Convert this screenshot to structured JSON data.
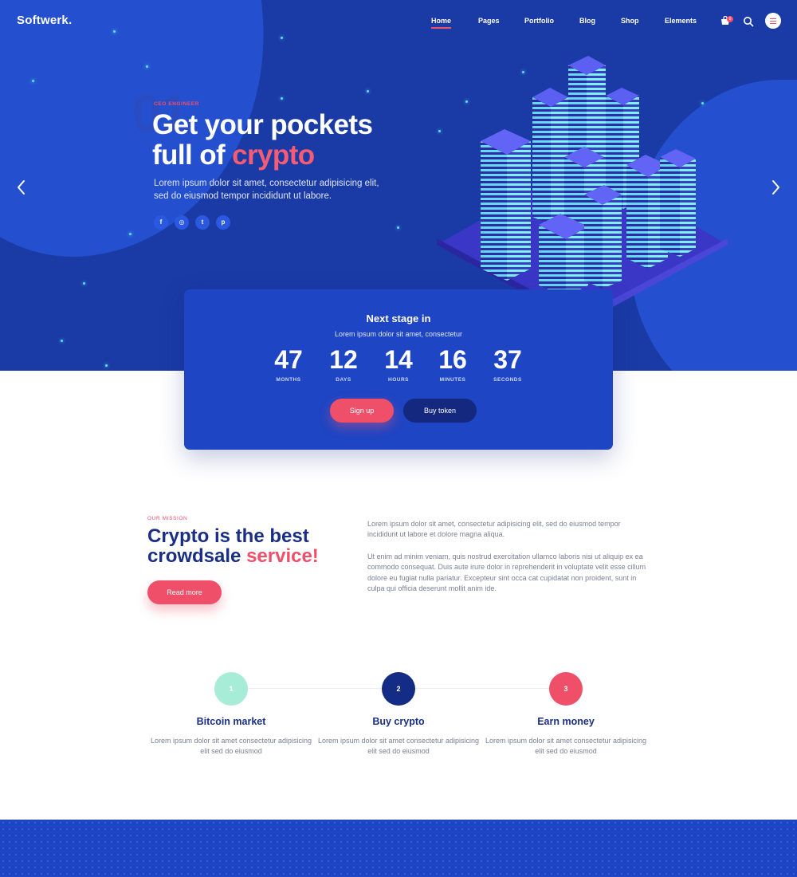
{
  "brand": {
    "logo": "Softwerk."
  },
  "nav": {
    "items": [
      {
        "label": "Home",
        "active": true
      },
      {
        "label": "Pages",
        "active": false
      },
      {
        "label": "Portfolio",
        "active": false
      },
      {
        "label": "Blog",
        "active": false
      },
      {
        "label": "Shop",
        "active": false
      },
      {
        "label": "Elements",
        "active": false
      }
    ],
    "cart_count": "0",
    "icons": [
      "cart-icon",
      "search-icon",
      "menu-icon"
    ]
  },
  "hero": {
    "slide_number": "01",
    "eyebrow": "CEO ENGINEER",
    "headline_line1": "Get your pockets",
    "headline_line2_plain": "full of ",
    "headline_line2_highlight": "crypto",
    "description": "Lorem ipsum dolor sit amet, consectetur adipisicing elit, sed do eiusmod tempor incididunt ut labore.",
    "socials": [
      {
        "icon": "facebook-icon",
        "glyph": "f"
      },
      {
        "icon": "instagram-icon",
        "glyph": "◎"
      },
      {
        "icon": "twitter-icon",
        "glyph": "t"
      },
      {
        "icon": "pinterest-icon",
        "glyph": "p"
      }
    ]
  },
  "countdown": {
    "title": "Next stage in",
    "subtitle": "Lorem ipsum dolor sit amet, consectetur",
    "units": [
      {
        "value": "47",
        "label": "MONTHS"
      },
      {
        "value": "12",
        "label": "DAYS"
      },
      {
        "value": "14",
        "label": "HOURS"
      },
      {
        "value": "16",
        "label": "MINUTES"
      },
      {
        "value": "37",
        "label": "SECONDS"
      }
    ],
    "signup_label": "Sign up",
    "buy_label": "Buy token"
  },
  "mission": {
    "eyebrow": "OUR MISSION",
    "title_line1": "Crypto is the best",
    "title_line2_plain": "crowdsale ",
    "title_line2_highlight": "service!",
    "button_label": "Read more",
    "paragraph1": "Lorem ipsum dolor sit amet, consectetur adipisicing elit, sed do eiusmod tempor incididunt ut labore et dolore magna aliqua.",
    "paragraph2": "Ut enim ad minim veniam, quis nostrud exercitation ullamco laboris nisi ut aliquip ex ea commodo consequat. Duis aute irure dolor in reprehenderit in voluptate velit esse cillum dolore eu fugiat nulla pariatur. Excepteur sint occa cat cupidatat non proident, sunt in culpa qui officia deserunt mollit anim ide."
  },
  "steps": [
    {
      "number": "1",
      "title": "Bitcoin market",
      "text": "Lorem ipsum dolor sit amet consectetur adipisicing elit sed do eiusmod",
      "color": "#a6ecd7"
    },
    {
      "number": "2",
      "title": "Buy crypto",
      "text": "Lorem ipsum dolor sit amet consectetur adipisicing elit sed do eiusmod",
      "color": "#152c86"
    },
    {
      "number": "3",
      "title": "Earn money",
      "text": "Lorem ipsum dolor sit amet consectetur adipisicing elit sed do eiusmod",
      "color": "#f04f6a"
    }
  ],
  "colors": {
    "hero_bg": "#1a3aa6",
    "accent": "#f04f6a",
    "card_bg": "#1e45c4",
    "heading": "#1a2f84"
  }
}
